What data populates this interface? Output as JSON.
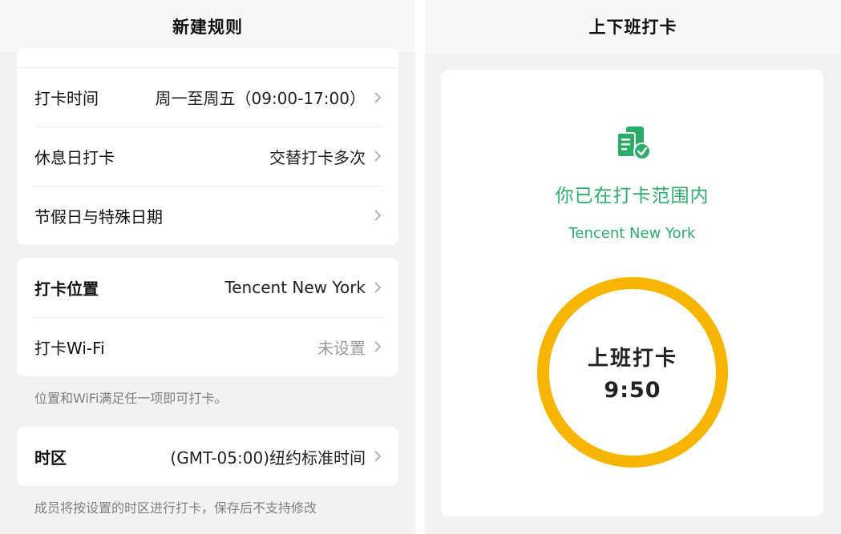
{
  "left": {
    "header_title": "新建规则",
    "schedule_card": [
      {
        "label": "打卡时间",
        "value": "周一至周五（09:00-17:00）"
      },
      {
        "label": "休息日打卡",
        "value": "交替打卡多次"
      },
      {
        "label": "节假日与特殊日期",
        "value": ""
      }
    ],
    "location_card": [
      {
        "label": "打卡位置",
        "value": "Tencent New York"
      },
      {
        "label": "打卡Wi-Fi",
        "value": "未设置"
      }
    ],
    "location_note": "位置和WiFi满足任一项即可打卡。",
    "timezone_card": {
      "label": "时区",
      "value": "(GMT-05:00)纽约标准时间"
    },
    "timezone_note": "成员将按设置的时区进行打卡，保存后不支持修改"
  },
  "right": {
    "header_title": "上下班打卡",
    "status_icon": "clipboard-check-icon",
    "status_title": "你已在打卡范围内",
    "status_location": "Tencent New York",
    "punch_label": "上班打卡",
    "punch_time": "9:50"
  },
  "colors": {
    "accent_green": "#2aae67",
    "ring_yellow": "#f7b500",
    "background": "#f2f2f3"
  }
}
